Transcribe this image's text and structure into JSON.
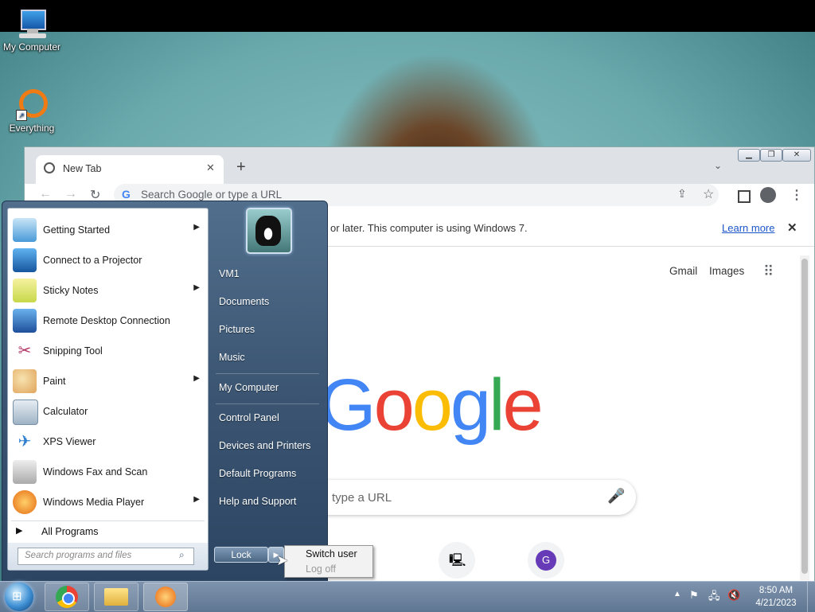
{
  "desktop": {
    "icons": [
      {
        "label": "My Computer",
        "icon": "computer-icon"
      },
      {
        "label": "Everything",
        "icon": "everything-icon"
      }
    ]
  },
  "browser": {
    "tab_title": "New Tab",
    "new_tab": "+",
    "search_placeholder": "Search Google or type a URL",
    "infobar_text": "or later. This computer is using Windows 7.",
    "infobar_link": "Learn more",
    "links": {
      "gmail": "Gmail",
      "images": "Images"
    },
    "logo": "Google",
    "searchbox_text": "type a URL",
    "shortcut_letter": "G"
  },
  "start_menu": {
    "programs": [
      {
        "label": "Getting Started",
        "submenu": true,
        "icon": "getting-started-icon"
      },
      {
        "label": "Connect to a Projector",
        "submenu": false,
        "icon": "projector-icon"
      },
      {
        "label": "Sticky Notes",
        "submenu": true,
        "icon": "sticky-notes-icon"
      },
      {
        "label": "Remote Desktop Connection",
        "submenu": false,
        "icon": "remote-desktop-icon"
      },
      {
        "label": "Snipping Tool",
        "submenu": false,
        "icon": "scissors-icon"
      },
      {
        "label": "Paint",
        "submenu": true,
        "icon": "paint-icon"
      },
      {
        "label": "Calculator",
        "submenu": false,
        "icon": "calculator-icon"
      },
      {
        "label": "XPS Viewer",
        "submenu": false,
        "icon": "xps-viewer-icon"
      },
      {
        "label": "Windows Fax and Scan",
        "submenu": false,
        "icon": "fax-icon"
      },
      {
        "label": "Windows Media Player",
        "submenu": true,
        "icon": "media-player-icon"
      }
    ],
    "all_programs": "All Programs",
    "search_placeholder": "Search programs and files",
    "right_items": {
      "user": "VM1",
      "documents": "Documents",
      "pictures": "Pictures",
      "music": "Music",
      "my_computer": "My Computer",
      "control_panel": "Control Panel",
      "devices": "Devices and Printers",
      "default_programs": "Default Programs",
      "help": "Help and Support"
    },
    "lock_button": "Lock",
    "power_menu": {
      "switch_user": "Switch user",
      "log_off": "Log off"
    }
  },
  "taskbar": {
    "time": "8:50 AM",
    "date": "4/21/2023"
  }
}
